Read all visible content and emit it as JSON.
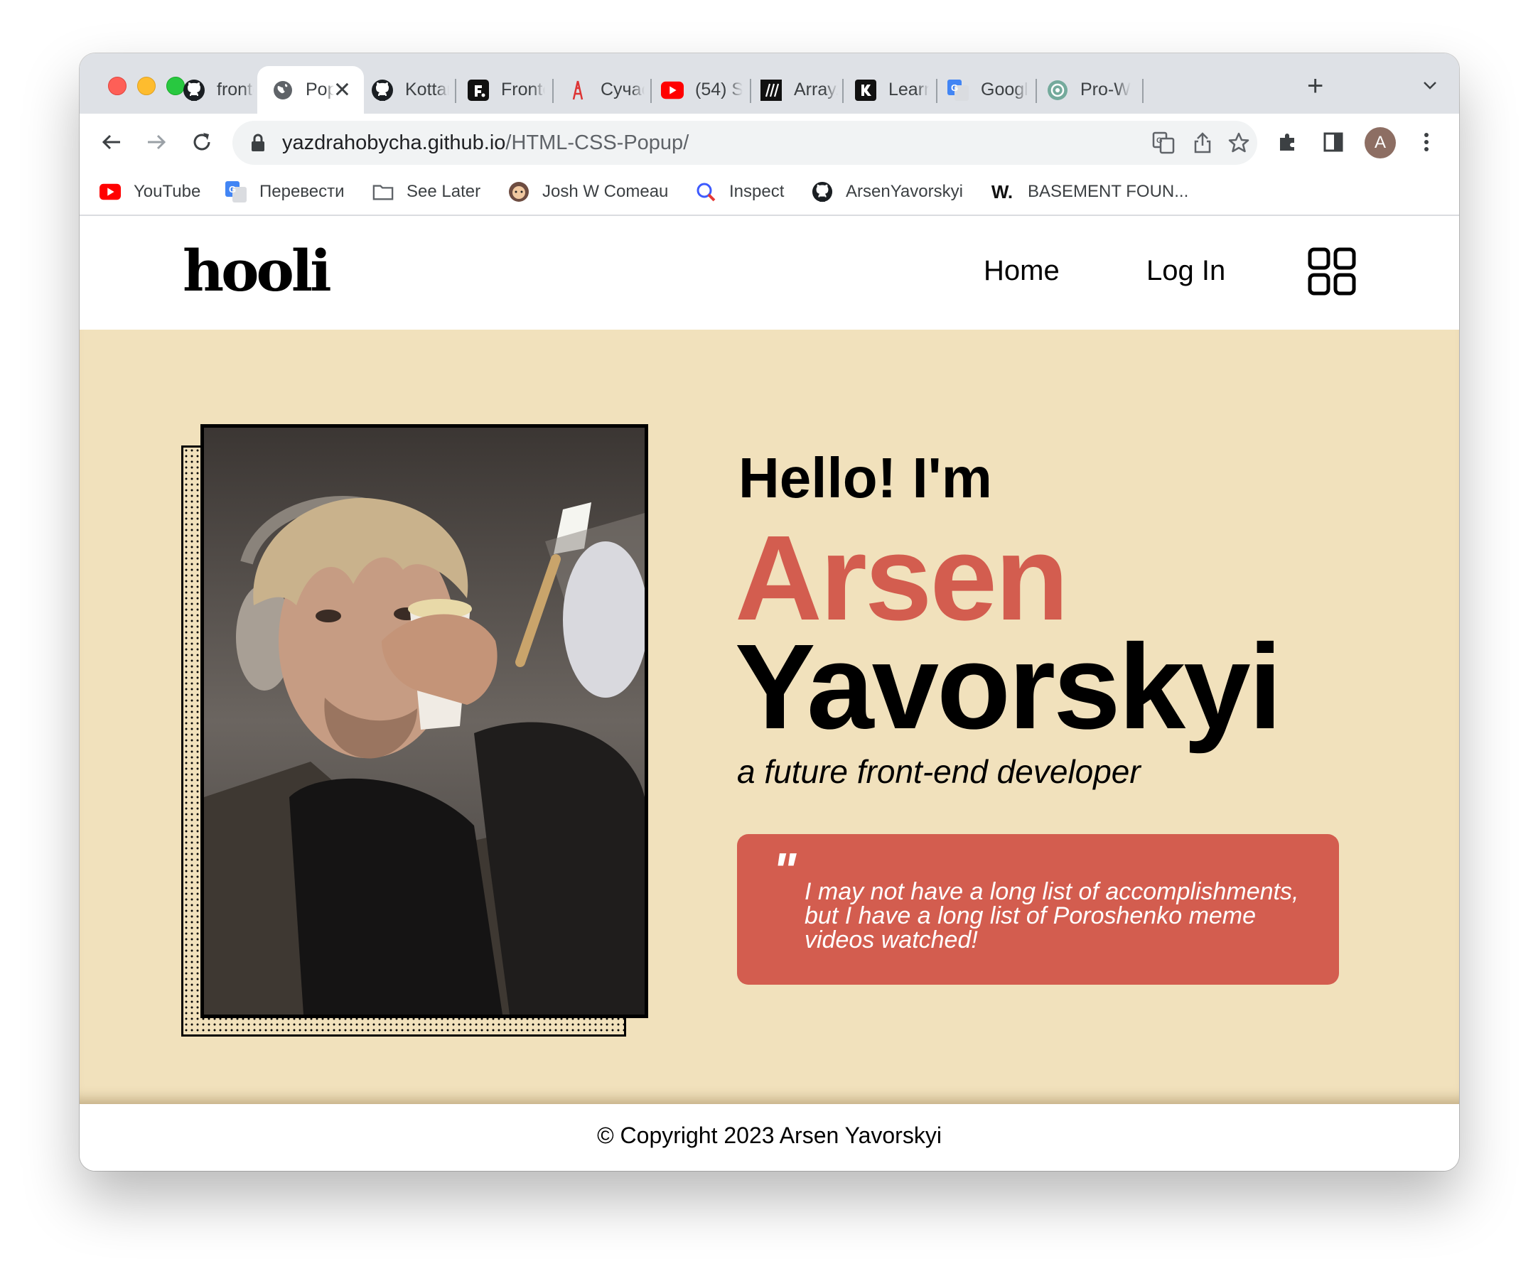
{
  "browser": {
    "tabs": [
      {
        "title": "frontend",
        "icon": "github-icon"
      },
      {
        "title": "Popup",
        "icon": "globe-icon",
        "active": true
      },
      {
        "title": "Kottans",
        "icon": "github-icon"
      },
      {
        "title": "Frontend",
        "icon": "frontend-mentor-icon"
      },
      {
        "title": "Сучасна",
        "icon": "tower-icon"
      },
      {
        "title": "(54) S",
        "icon": "youtube-icon"
      },
      {
        "title": "Array.",
        "icon": "mdn-icon"
      },
      {
        "title": "Learn",
        "icon": "learn-icon"
      },
      {
        "title": "Google",
        "icon": "google-translate-icon"
      },
      {
        "title": "Pro-W",
        "icon": "chatgpt-icon"
      }
    ],
    "url": {
      "host": "yazdrahobycha.github.io",
      "path": "/HTML-CSS-Popup/"
    },
    "profile_initial": "A",
    "bookmarks": [
      {
        "label": "YouTube",
        "icon": "youtube-icon"
      },
      {
        "label": "Перевести",
        "icon": "google-translate-icon"
      },
      {
        "label": "See Later",
        "icon": "folder-icon"
      },
      {
        "label": "Josh W Comeau",
        "icon": "avatar-icon"
      },
      {
        "label": "Inspect",
        "icon": "inspect-icon"
      },
      {
        "label": "ArsenYavorskyi",
        "icon": "github-icon"
      },
      {
        "label": "BASEMENT FOUN...",
        "icon": "w-logo-icon",
        "icon_text": "W."
      }
    ]
  },
  "site": {
    "logo": "hooli",
    "nav": {
      "home": "Home",
      "login": "Log In"
    },
    "hero": {
      "greeting": "Hello! I'm",
      "first_name": "Arsen",
      "last_name": "Yavorskyi",
      "tagline": "a future front-end developer",
      "quote_mark": "\"",
      "quote": "I may not have a long list of accomplishments, but I have a long list of Poroshenko meme videos watched!"
    },
    "footer": "© Copyright 2023 Arsen Yavorskyi"
  },
  "colors": {
    "accent": "#d35d4f",
    "hero_bg": "#f1e1bc",
    "text": "#000000"
  }
}
